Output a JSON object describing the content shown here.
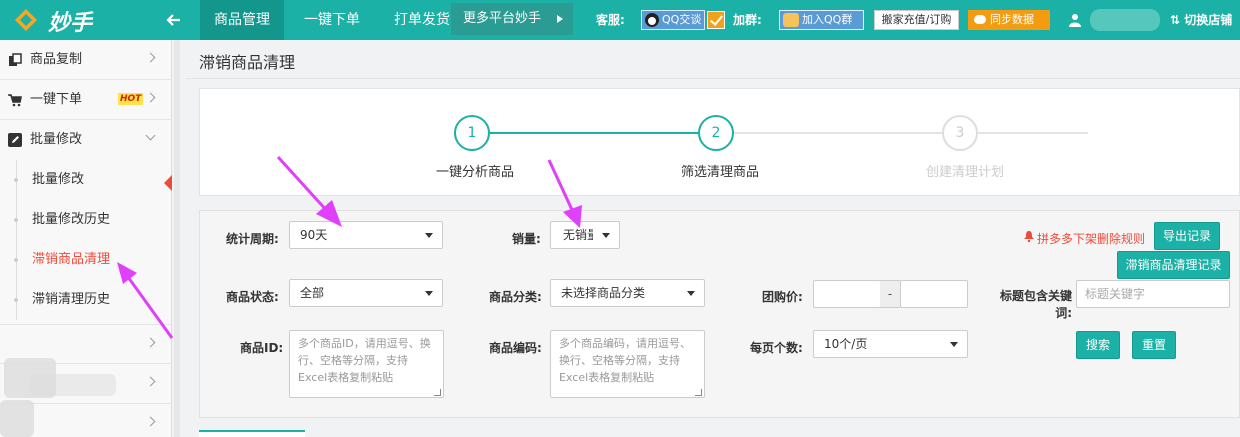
{
  "brand": {
    "name": "妙手"
  },
  "topnav": {
    "tabs": [
      "商品管理",
      "一键下单",
      "打单发货"
    ],
    "more_platform": "更多平台妙手",
    "service_label": "客服:",
    "qq_chat": "QQ交谈",
    "join_label": "加群:",
    "join_qq_group": "加入QQ群",
    "recharge": "搬家充值/订购",
    "sync": "同步数据",
    "switch_store": "切换店铺"
  },
  "sidebar": {
    "items": [
      {
        "label": "商品复制"
      },
      {
        "label": "一键下单",
        "badge": "HOT"
      },
      {
        "label": "批量修改"
      }
    ],
    "sub_items": [
      {
        "label": "批量修改"
      },
      {
        "label": "批量修改历史"
      },
      {
        "label": "滞销商品清理"
      },
      {
        "label": "滞销清理历史"
      }
    ]
  },
  "page": {
    "title": "滞销商品清理"
  },
  "steps": [
    {
      "num": "1",
      "label": "一键分析商品"
    },
    {
      "num": "2",
      "label": "筛选清理商品"
    },
    {
      "num": "3",
      "label": "创建清理计划"
    }
  ],
  "filters": {
    "period_label": "统计周期:",
    "period_value": "90天",
    "sales_label": "销量:",
    "sales_value": "无销量",
    "rule_link": "拼多多下架删除规则",
    "export_btn": "导出记录",
    "clean_record_btn": "滞销商品清理记录",
    "status_label": "商品状态:",
    "status_value": "全部",
    "category_label": "商品分类:",
    "category_value": "未选择商品分类",
    "group_price_label": "团购价:",
    "price_sep": "-",
    "keyword_label": "标题包含关键词:",
    "keyword_placeholder": "标题关键字",
    "id_label": "商品ID:",
    "id_placeholder": "多个商品ID，请用逗号、换行、空格等分隔，支持Excel表格复制粘贴",
    "code_label": "商品编码:",
    "code_placeholder": "多个商品编码，请用逗号、换行、空格等分隔，支持Excel表格复制粘贴",
    "per_page_label": "每页个数:",
    "per_page_value": "10个/页",
    "search_btn": "搜索",
    "reset_btn": "重置"
  },
  "colors": {
    "teal": "#1cb1a6",
    "red": "#f04b3a",
    "orange": "#f39c12",
    "annotation": "#e040fb"
  }
}
